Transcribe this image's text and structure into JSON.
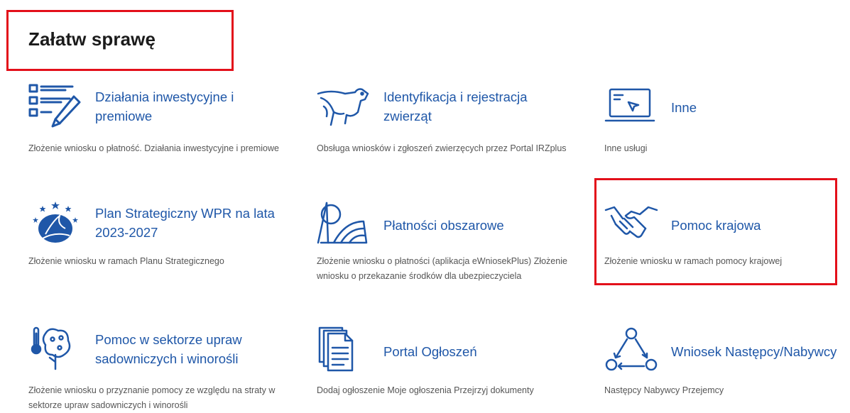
{
  "page": {
    "title": "Załatw sprawę"
  },
  "tiles": [
    {
      "title": "Działania inwestycyjne i premiowe",
      "desc": "Złożenie wniosku o płatność. Działania inwestycyjne i premiowe",
      "icon": "form-pencil-icon"
    },
    {
      "title": "Identyfikacja i rejestracja zwierząt",
      "desc": "Obsługa wniosków i zgłoszeń zwierzęcych przez Portal IRZplus",
      "icon": "cow-icon"
    },
    {
      "title": "Inne",
      "desc": "Inne usługi",
      "icon": "laptop-cursor-icon"
    },
    {
      "title": "Plan Strategiczny WPR na lata 2023-2027",
      "desc": "Złożenie wniosku w ramach Planu Strategicznego",
      "icon": "wpr-logo-icon"
    },
    {
      "title": "Płatności obszarowe",
      "desc": "Złożenie wniosku o płatności (aplikacja eWniosekPlus) Złożenie wniosku o przekazanie środków dla ubezpieczyciela",
      "icon": "field-sun-icon"
    },
    {
      "title": "Pomoc krajowa",
      "desc": "Złożenie wniosku w ramach pomocy krajowej",
      "icon": "handshake-icon"
    },
    {
      "title": "Pomoc w sektorze upraw sadowniczych i winorośli",
      "desc": "Złożenie wniosku o przyznanie pomocy ze względu na straty w sektorze upraw sadowniczych i winorośli",
      "icon": "tree-thermometer-icon"
    },
    {
      "title": "Portal Ogłoszeń",
      "desc": "Dodaj ogłoszenie Moje ogłoszenia Przejrzyj dokumenty",
      "icon": "documents-icon"
    },
    {
      "title": "Wniosek Następcy/Nabywcy",
      "desc": "Następcy Nabywcy Przejemcy",
      "icon": "people-cycle-icon"
    }
  ],
  "colors": {
    "accent": "#1f57a8",
    "highlight": "#e3101a",
    "text": "#555555"
  }
}
